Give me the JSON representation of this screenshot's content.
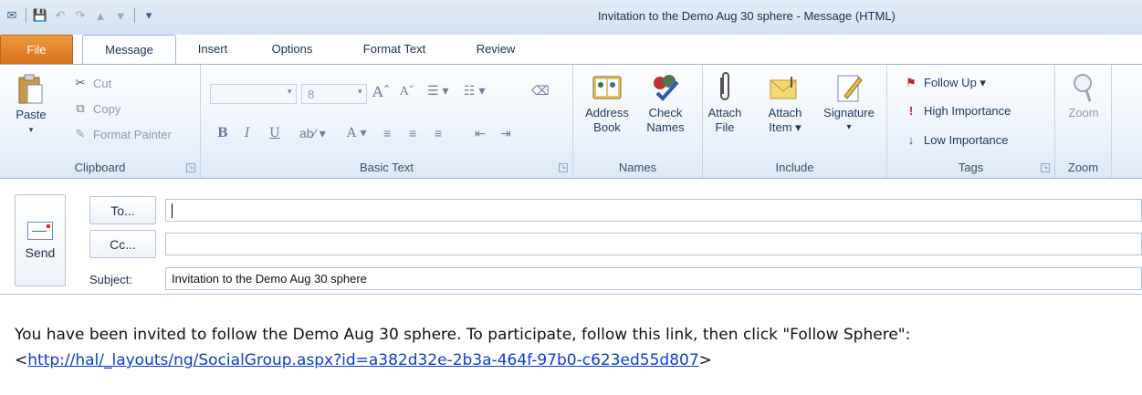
{
  "window": {
    "title": "Invitation to the Demo Aug 30 sphere  -  Message (HTML)"
  },
  "qat": [
    {
      "name": "outlook-icon",
      "glyph": "✉"
    },
    {
      "name": "save-icon",
      "glyph": "💾"
    },
    {
      "name": "undo-icon",
      "glyph": "↶"
    },
    {
      "name": "redo-icon",
      "glyph": "↷"
    },
    {
      "name": "previous-item-icon",
      "glyph": "▲"
    },
    {
      "name": "next-item-icon",
      "glyph": "▼"
    },
    {
      "name": "customize-qat-icon",
      "glyph": "▾"
    }
  ],
  "tabs": {
    "file": "File",
    "message": "Message",
    "insert": "Insert",
    "options": "Options",
    "format_text": "Format Text",
    "review": "Review"
  },
  "clipboard": {
    "paste": "Paste",
    "cut": "Cut",
    "copy": "Copy",
    "format_painter": "Format Painter",
    "group_label": "Clipboard"
  },
  "basic_text": {
    "font_size": "8",
    "bold": "B",
    "italic": "I",
    "underline": "U",
    "grow_font": "Aˆ",
    "shrink_font": "Aˇ",
    "group_label": "Basic Text"
  },
  "names": {
    "address_book": [
      "Address",
      "Book"
    ],
    "check_names": [
      "Check",
      "Names"
    ],
    "group_label": "Names"
  },
  "include": {
    "attach_file": [
      "Attach",
      "File"
    ],
    "attach_item": [
      "Attach",
      "Item ▾"
    ],
    "signature": [
      "Signature",
      "▾"
    ],
    "group_label": "Include"
  },
  "tags": {
    "follow_up": "Follow Up ▾",
    "high_importance": "High Importance",
    "low_importance": "Low Importance",
    "group_label": "Tags"
  },
  "zoom": {
    "zoom": "Zoom",
    "group_label": "Zoom"
  },
  "header": {
    "send": "Send",
    "to_button": "To...",
    "cc_button": "Cc...",
    "subject_label": "Subject:",
    "to_value": "",
    "cc_value": "",
    "subject_value": "Invitation to the Demo Aug 30 sphere"
  },
  "body": {
    "line1": "You have been invited to follow the Demo Aug 30 sphere.  To participate, follow this link, then click \"Follow Sphere\":",
    "link_open": "<",
    "link": "http://hal/_layouts/ng/SocialGroup.aspx?id=a382d32e-2b3a-464f-97b0-c623ed55d807",
    "link_close": ">"
  },
  "colors": {
    "file_tab": "#e07a22",
    "link": "#0b3fcf",
    "accent": "#1e395b"
  }
}
